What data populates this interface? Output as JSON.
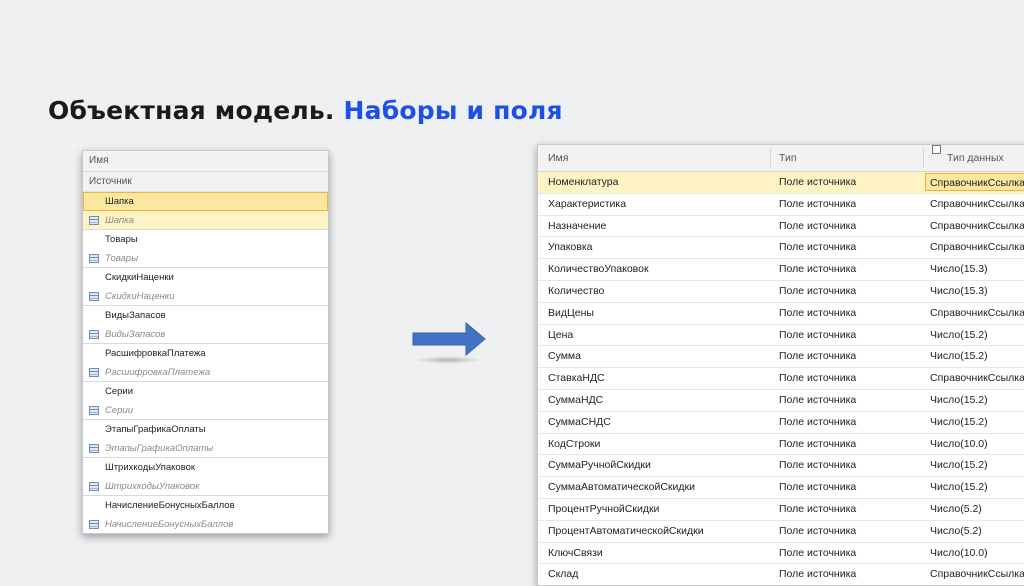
{
  "title": {
    "main": "Объектная модель.",
    "accent": "Наборы и поля"
  },
  "left_panel": {
    "header": "Имя",
    "source": "Источник",
    "items": [
      {
        "name": "Шапка",
        "set": "Шапка"
      },
      {
        "name": "Товары",
        "set": "Товары"
      },
      {
        "name": "СкидкиНаценки",
        "set": "СкидкиНаценки"
      },
      {
        "name": "ВидыЗапасов",
        "set": "ВидыЗапасов"
      },
      {
        "name": "РасшифровкаПлатежа",
        "set": "РасшифровкаПлатежа"
      },
      {
        "name": "Серии",
        "set": "Серии"
      },
      {
        "name": "ЭтапыГрафикаОплаты",
        "set": "ЭтапыГрафикаОплаты"
      },
      {
        "name": "ШтрихкодыУпаковок",
        "set": "ШтрихкодыУпаковок"
      },
      {
        "name": "НачислениеБонусныхБаллов",
        "set": "НачислениеБонусныхБаллов"
      }
    ]
  },
  "right_panel": {
    "columns": [
      "Имя",
      "Тип",
      "Тип данных"
    ],
    "rows": [
      [
        "Номенклатура",
        "Поле источника",
        "СправочникСсылка"
      ],
      [
        "Характеристика",
        "Поле источника",
        "СправочникСсылка"
      ],
      [
        "Назначение",
        "Поле источника",
        "СправочникСсылка"
      ],
      [
        "Упаковка",
        "Поле источника",
        "СправочникСсылка"
      ],
      [
        "КоличествоУпаковок",
        "Поле источника",
        "Число(15.3)"
      ],
      [
        "Количество",
        "Поле источника",
        "Число(15.3)"
      ],
      [
        "ВидЦены",
        "Поле источника",
        "СправочникСсылка"
      ],
      [
        "Цена",
        "Поле источника",
        "Число(15.2)"
      ],
      [
        "Сумма",
        "Поле источника",
        "Число(15.2)"
      ],
      [
        "СтавкаНДС",
        "Поле источника",
        "СправочникСсылка"
      ],
      [
        "СуммаНДС",
        "Поле источника",
        "Число(15.2)"
      ],
      [
        "СуммаСНДС",
        "Поле источника",
        "Число(15.2)"
      ],
      [
        "КодСтроки",
        "Поле источника",
        "Число(10.0)"
      ],
      [
        "СуммаРучнойСкидки",
        "Поле источника",
        "Число(15.2)"
      ],
      [
        "СуммаАвтоматическойСкидки",
        "Поле источника",
        "Число(15.2)"
      ],
      [
        "ПроцентРучнойСкидки",
        "Поле источника",
        "Число(5.2)"
      ],
      [
        "ПроцентАвтоматическойСкидки",
        "Поле источника",
        "Число(5.2)"
      ],
      [
        "КлючСвязи",
        "Поле источника",
        "Число(10.0)"
      ],
      [
        "Склад",
        "Поле источника",
        "СправочникСсылка"
      ]
    ]
  },
  "colors": {
    "accent": "#1f50e6",
    "selection": "#fdf3c4",
    "selection_border": "#e8b83a",
    "arrow": "#4472c4"
  }
}
